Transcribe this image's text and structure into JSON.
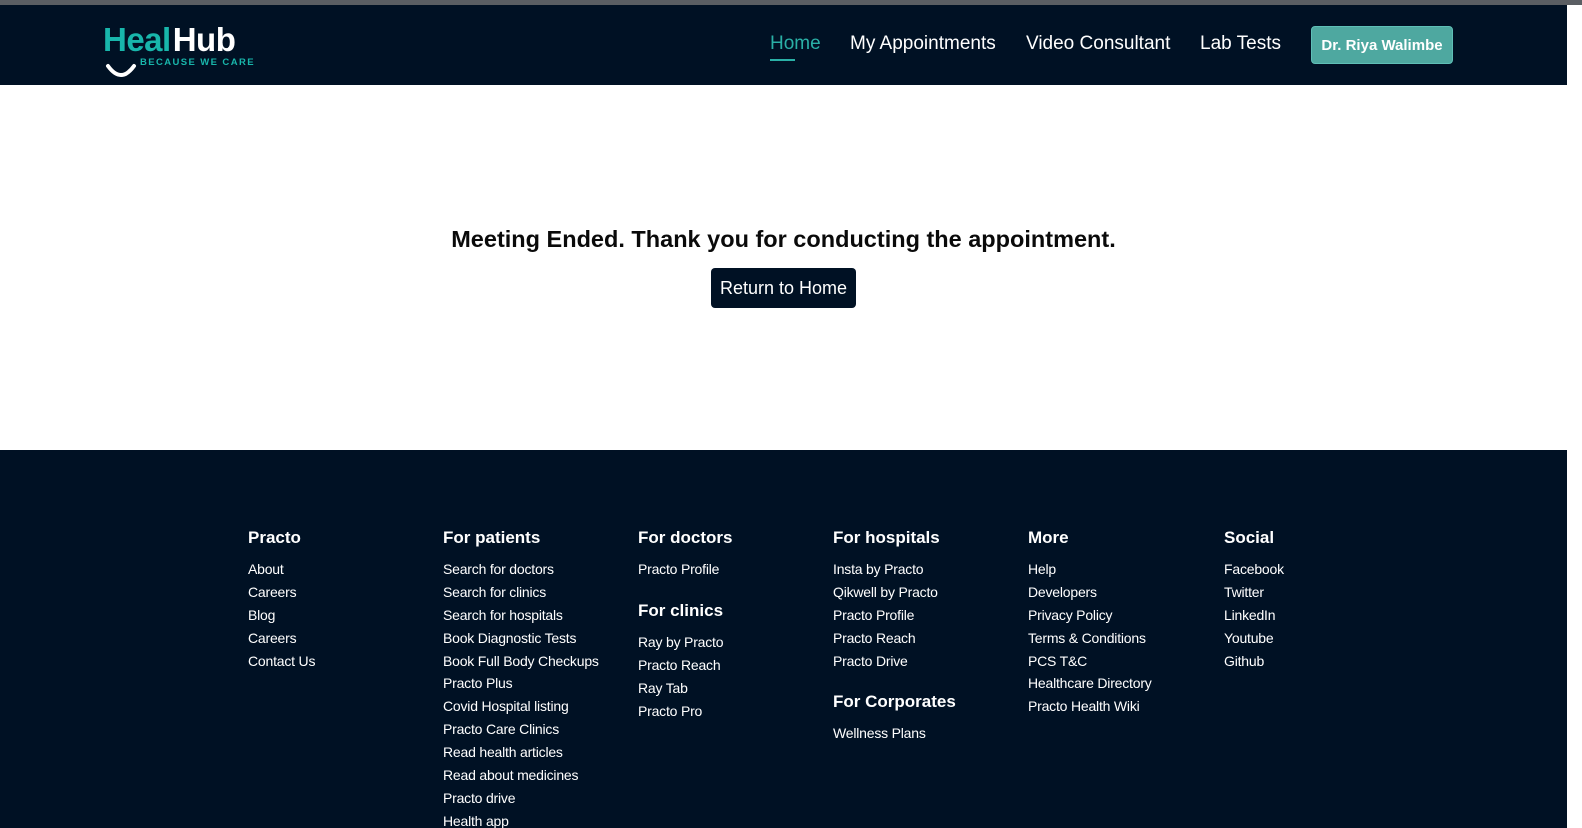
{
  "brand": {
    "name_part1": "Heal",
    "name_part2": "Hub",
    "tagline": "BECAUSE WE CARE",
    "accent_color": "#18b6ab",
    "navbar_color": "#001124"
  },
  "nav": {
    "items": [
      {
        "label": "Home",
        "active": true
      },
      {
        "label": "My Appointments",
        "active": false
      },
      {
        "label": "Video Consultant",
        "active": false
      },
      {
        "label": "Lab Tests",
        "active": false
      }
    ],
    "user_button": "Dr. Riya Walimbe"
  },
  "main": {
    "message": "Meeting Ended. Thank you for conducting the appointment.",
    "return_button": "Return to Home"
  },
  "footer": {
    "practo": {
      "title": "Practo",
      "links": [
        "About",
        "Careers",
        "Blog",
        "Careers",
        "Contact Us"
      ]
    },
    "patients": {
      "title": "For patients",
      "links": [
        "Search for doctors",
        "Search for clinics",
        "Search for hospitals",
        "Book Diagnostic Tests",
        "Book Full Body Checkups",
        "Practo Plus",
        "Covid Hospital listing",
        "Practo Care Clinics",
        "Read health articles",
        "Read about medicines",
        "Practo drive",
        "Health app"
      ]
    },
    "doctors": {
      "title": "For doctors",
      "links": [
        "Practo Profile"
      ]
    },
    "clinics": {
      "title": "For clinics",
      "links": [
        "Ray by Practo",
        "Practo Reach",
        "Ray Tab",
        "Practo Pro"
      ]
    },
    "hospitals": {
      "title": "For hospitals",
      "links": [
        "Insta by Practo",
        "Qikwell by Practo",
        "Practo Profile",
        "Practo Reach",
        "Practo Drive"
      ]
    },
    "corporates": {
      "title": "For Corporates",
      "links": [
        "Wellness Plans"
      ]
    },
    "more": {
      "title": "More",
      "links": [
        "Help",
        "Developers",
        "Privacy Policy",
        "Terms & Conditions",
        "PCS T&C",
        "Healthcare Directory",
        "Practo Health Wiki"
      ]
    },
    "social": {
      "title": "Social",
      "links": [
        "Facebook",
        "Twitter",
        "LinkedIn",
        "Youtube",
        "Github"
      ]
    }
  }
}
